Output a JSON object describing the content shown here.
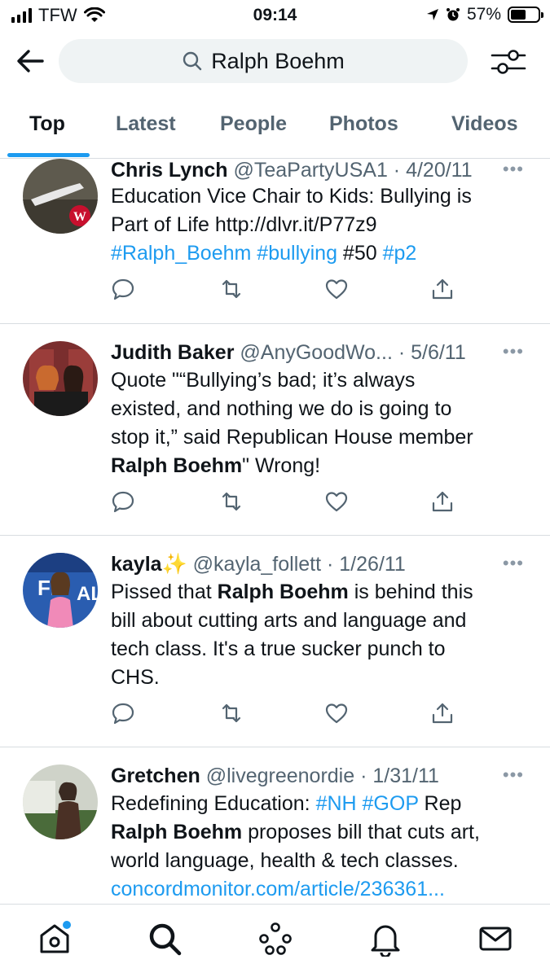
{
  "status": {
    "carrier": "TFW",
    "time": "09:14",
    "battery": "57%",
    "battery_level": 0.57
  },
  "search": {
    "query": "Ralph Boehm"
  },
  "tabs": [
    "Top",
    "Latest",
    "People",
    "Photos",
    "Videos"
  ],
  "active_tab": "Top",
  "tweets": [
    {
      "name": "Chris Lynch",
      "handle": "@TeaPartyUSA1",
      "date": "4/20/11",
      "lines": [
        [
          {
            "t": "Education Vice Chair to Kids: Bullying is",
            "s": "n"
          }
        ],
        [
          {
            "t": "Part of Life http://dlvr.it/P77z9",
            "s": "n"
          }
        ],
        [
          {
            "t": "#Ralph_Boehm",
            "s": "l"
          },
          {
            "t": " ",
            "s": "n"
          },
          {
            "t": "#bullying",
            "s": "l"
          },
          {
            "t": " #50 ",
            "s": "n"
          },
          {
            "t": "#p2",
            "s": "l"
          }
        ]
      ]
    },
    {
      "name": "Judith Baker",
      "handle": "@AnyGoodWo...",
      "date": "5/6/11",
      "lines": [
        [
          {
            "t": "Quote \"“Bullying’s bad; it’s always",
            "s": "n"
          }
        ],
        [
          {
            "t": "existed, and nothing we do is going to",
            "s": "n"
          }
        ],
        [
          {
            "t": "stop it,” said Republican House member",
            "s": "n"
          }
        ],
        [
          {
            "t": "Ralph Boehm",
            "s": "b"
          },
          {
            "t": "\"  Wrong!",
            "s": "n"
          }
        ]
      ]
    },
    {
      "name": "kayla",
      "name_emoji": "✨",
      "handle": "@kayla_follett",
      "date": "1/26/11",
      "lines": [
        [
          {
            "t": "Pissed that ",
            "s": "n"
          },
          {
            "t": "Ralph Boehm",
            "s": "b"
          },
          {
            "t": " is behind this",
            "s": "n"
          }
        ],
        [
          {
            "t": "bill about cutting arts and language and",
            "s": "n"
          }
        ],
        [
          {
            "t": "tech class. It's a true sucker punch to",
            "s": "n"
          }
        ],
        [
          {
            "t": "CHS.",
            "s": "n"
          }
        ]
      ]
    },
    {
      "name": "Gretchen",
      "handle": "@livegreenordie",
      "date": "1/31/11",
      "lines": [
        [
          {
            "t": "Redefining Education: ",
            "s": "n"
          },
          {
            "t": "#NH",
            "s": "l"
          },
          {
            "t": " ",
            "s": "n"
          },
          {
            "t": "#GOP",
            "s": "l"
          },
          {
            "t": " Rep",
            "s": "n"
          }
        ],
        [
          {
            "t": "Ralph Boehm",
            "s": "b"
          },
          {
            "t": " proposes bill that cuts art,",
            "s": "n"
          }
        ],
        [
          {
            "t": "world language, health & tech classes.",
            "s": "n"
          }
        ],
        [
          {
            "t": "concordmonitor.com/article/236361...",
            "s": "l"
          }
        ]
      ]
    }
  ],
  "colors": {
    "accent": "#1d9bf0",
    "secondary_text": "#536471",
    "divider": "#d8dde1"
  },
  "icons": [
    "back-arrow-icon",
    "search-icon",
    "filter-icon",
    "reply-icon",
    "retweet-icon",
    "like-icon",
    "share-icon",
    "home-icon",
    "explore-icon",
    "spaces-icon",
    "notifications-icon",
    "messages-icon"
  ]
}
